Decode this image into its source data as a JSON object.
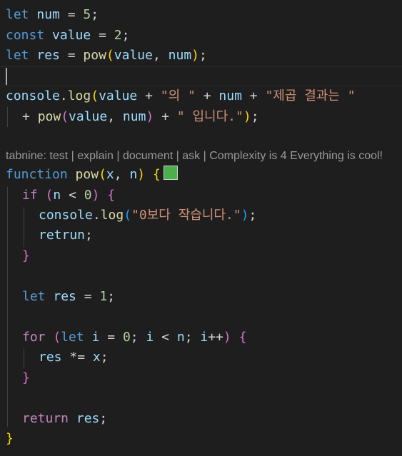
{
  "editor": {
    "lines": [
      [
        "let",
        "num",
        "=",
        "5",
        ";"
      ],
      [
        "const",
        "value",
        "=",
        "2",
        ";"
      ],
      [
        "let",
        "res",
        "=",
        "pow",
        "(",
        "value",
        ",",
        "num",
        ")",
        ";"
      ],
      [],
      [
        "console",
        ".",
        "log",
        "(",
        "value",
        "+",
        "\"의 \"",
        "+",
        "num",
        "+",
        "\"제곱 결과는 \""
      ],
      [
        "+",
        "pow",
        "(",
        "value",
        ",",
        "num",
        ")",
        "+",
        "\" 입니다.\"",
        ")",
        ";"
      ],
      [],
      [
        "function",
        "pow",
        "(",
        "x",
        ",",
        "n",
        ")",
        "{"
      ],
      [
        "if",
        "(",
        "n",
        "<",
        "0",
        ")",
        "{"
      ],
      [
        "console",
        ".",
        "log",
        "(",
        "\"0보다 작습니다.\"",
        ")",
        ";"
      ],
      [
        "retrun",
        ";"
      ],
      [
        "}"
      ],
      [],
      [
        "let",
        "res",
        "=",
        "1",
        ";"
      ],
      [],
      [
        "for",
        "(",
        "let",
        "i",
        "=",
        "0",
        ";",
        "i",
        "<",
        "n",
        ";",
        "i",
        "++",
        ")",
        "{"
      ],
      [
        "res",
        "*=",
        "x",
        ";"
      ],
      [
        "}"
      ],
      [],
      [
        "return",
        "res",
        ";"
      ],
      [
        "}"
      ]
    ],
    "codelens": "tabnine: test | explain | document | ask | Complexity is 4 Everything is cool!",
    "swatch_color": "#4bb04b"
  }
}
